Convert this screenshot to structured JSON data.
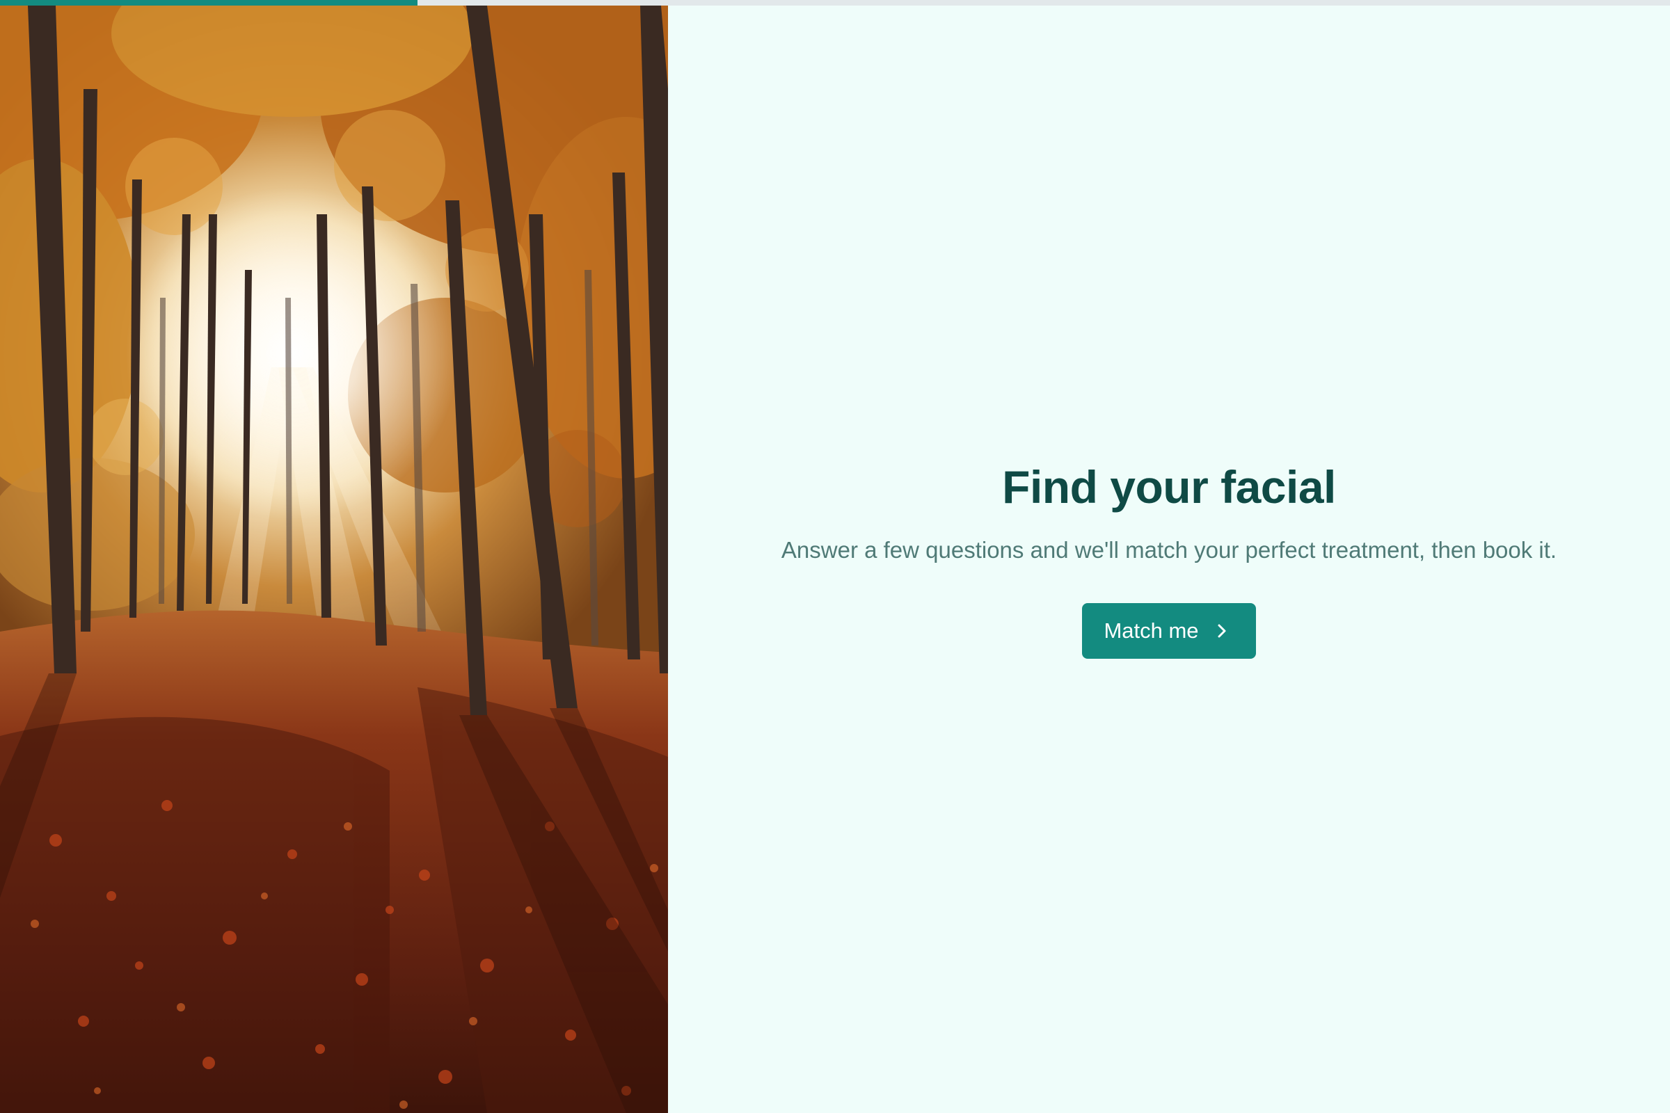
{
  "progress": {
    "value_percent": 25,
    "color": "#138b80",
    "track_color": "#e2e8ea"
  },
  "hero": {
    "title": "Find your facial",
    "subtitle": "Answer a few questions and we'll match your perfect treatment, then book it.",
    "cta_label": "Match me",
    "cta_icon": "chevron-right-icon"
  },
  "photo": {
    "subject": "autumn-forest-sunlight-image"
  },
  "colors": {
    "background": "#effdfa",
    "title": "#0f4a45",
    "subtitle": "#4f7a76",
    "accent": "#138b80"
  }
}
